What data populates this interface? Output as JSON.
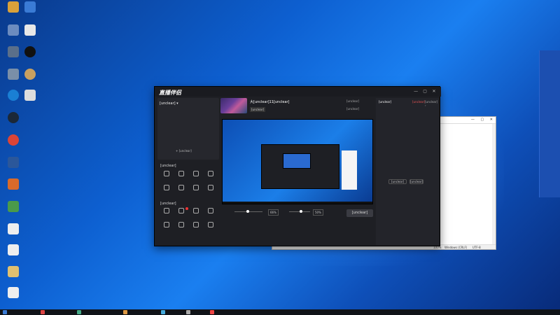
{
  "desktop": {
    "icons": [
      {
        "label": "",
        "color": "#d9a13a"
      },
      {
        "label": "",
        "color": "#3a7bd5"
      },
      {
        "label": "",
        "color": "#6c8cbf"
      },
      {
        "label": "",
        "color": "#e8e8e8"
      },
      {
        "label": "",
        "color": "#5a6f8a"
      },
      {
        "label": "",
        "color": "#111111"
      },
      {
        "label": "",
        "color": "#7a8fa8"
      },
      {
        "label": "",
        "color": "#c8a060"
      },
      {
        "label": "",
        "color": "#1a7fd4"
      },
      {
        "label": "",
        "color": "#dddddd"
      },
      {
        "label": "",
        "color": "#1b2838"
      },
      {
        "label": "",
        "color": "#db4437"
      },
      {
        "label": "",
        "color": "#2b579a"
      },
      {
        "label": "",
        "color": "#d86a2a"
      },
      {
        "label": "",
        "color": "#4a9a4a"
      },
      {
        "label": "",
        "color": "#eeeeee"
      },
      {
        "label": "",
        "color": "#eeeeee"
      },
      {
        "label": "",
        "color": "#e0c070"
      },
      {
        "label": "",
        "color": "#eeeeee"
      }
    ]
  },
  "app": {
    "name": "直播伴侣",
    "version": "",
    "window_buttons": [
      "—",
      "▢",
      "✕"
    ],
    "left": {
      "mode_label": "[unclear] ▾",
      "mode_right": "",
      "scene_header": "",
      "scene_items": [
        "",
        "",
        ""
      ],
      "add_source_label": "+ [unclear]",
      "section_interact": "[unclear]",
      "interact_tools": [
        "",
        "",
        "",
        "",
        "",
        "",
        "",
        ""
      ],
      "section_basic": "[unclear]",
      "basic_tools": [
        "",
        "",
        "",
        "",
        "",
        "",
        "",
        ""
      ],
      "more_label": ""
    },
    "center": {
      "game_title": "大[unclear]11[unclear]",
      "game_tag": "[unclear]",
      "top_actions": [
        "[unclear]",
        "[unclear]"
      ],
      "mic_pct": "66%",
      "speaker_pct": "50%",
      "ctrl_labels": [
        "",
        "",
        "",
        "",
        "",
        ""
      ],
      "live_button": "[unclear]",
      "status_left": "",
      "status_items": [
        "",
        "",
        "",
        "",
        ""
      ]
    },
    "right": {
      "tabs": [
        "[unclear]",
        "",
        "[unclear]",
        "[unclear] ›"
      ],
      "empty_hint": "",
      "btn_a": "[unclear]",
      "btn_b": "[unclear]"
    }
  },
  "notepad": {
    "status_pos": "",
    "status_zoom": "100%",
    "status_eol": "Windows (CRLF)",
    "status_enc": "UTF-8",
    "window_buttons": [
      "—",
      "▢",
      "✕"
    ]
  },
  "side_panel": {
    "lines": [
      "",
      "",
      "",
      "",
      "",
      "",
      "",
      "",
      "",
      "",
      ""
    ]
  },
  "taskbar": {
    "clock": ""
  },
  "colors": {
    "accent_red": "#e33333",
    "app_bg": "#1e1f24"
  }
}
